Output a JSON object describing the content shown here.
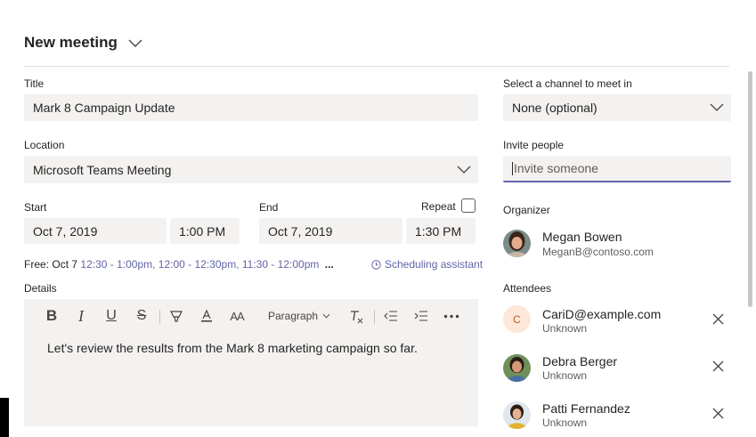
{
  "header": {
    "title": "New meeting"
  },
  "form": {
    "title_label": "Title",
    "title_value": "Mark 8 Campaign Update",
    "location_label": "Location",
    "location_value": "Microsoft Teams Meeting",
    "start_label": "Start",
    "start_date": "Oct 7, 2019",
    "start_time": "1:00 PM",
    "end_label": "End",
    "end_date": "Oct 7, 2019",
    "end_time": "1:30 PM",
    "repeat_label": "Repeat",
    "repeat_checked": false
  },
  "availability": {
    "prefix": "Free:",
    "day": "Oct 7",
    "slots": [
      "12:30 - 1:00pm,",
      "12:00 - 12:30pm,",
      "11:30 - 12:00pm"
    ],
    "more": "...",
    "scheduling_assistant": "Scheduling assistant"
  },
  "details": {
    "label": "Details",
    "toolbar": {
      "bold": "B",
      "italic": "I",
      "underline": "U",
      "strike": "S",
      "font_size": "AA",
      "paragraph": "Paragraph"
    },
    "body": "Let's review the results from the Mark 8 marketing campaign so far."
  },
  "channel": {
    "label": "Select a channel to meet in",
    "value": "None (optional)"
  },
  "invite": {
    "label": "Invite people",
    "placeholder": "Invite someone"
  },
  "organizer": {
    "label": "Organizer",
    "name": "Megan Bowen",
    "email": "MeganB@contoso.com"
  },
  "attendees": {
    "label": "Attendees",
    "items": [
      {
        "name": "CariD@example.com",
        "status": "Unknown",
        "initial": "C"
      },
      {
        "name": "Debra Berger",
        "status": "Unknown"
      },
      {
        "name": "Patti Fernandez",
        "status": "Unknown"
      }
    ]
  },
  "colors": {
    "accent": "#6264a7",
    "field_bg": "#f3f2f1",
    "text": "#252423",
    "secondary_text": "#605e5c"
  }
}
